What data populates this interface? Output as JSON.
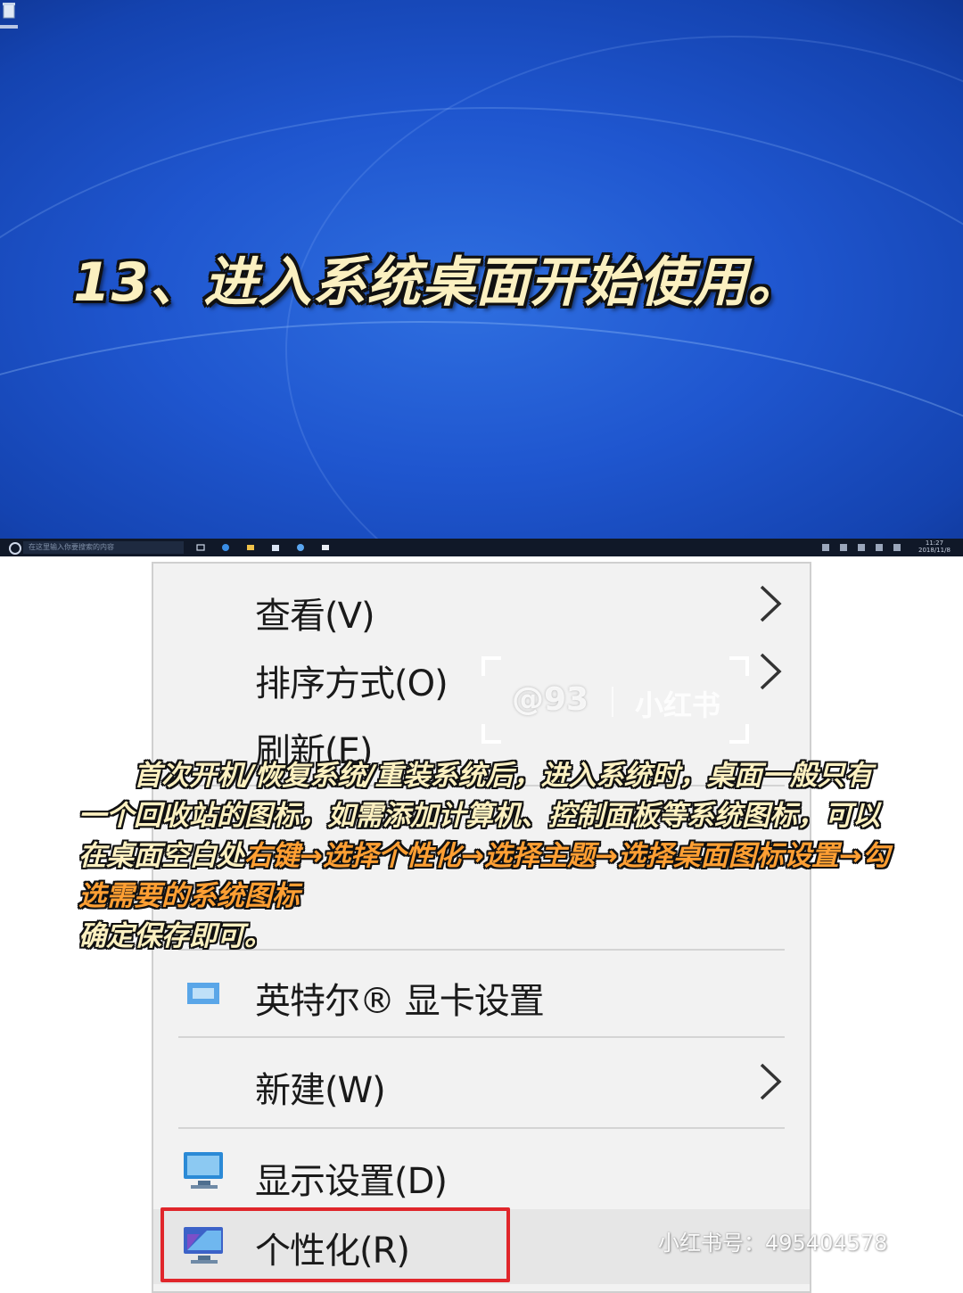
{
  "desktop": {
    "caption": "13、进入系统桌面开始使用。",
    "search_placeholder": "在这里输入你要搜索的内容",
    "clock_time": "11:27",
    "clock_date": "2018/11/8"
  },
  "context_menu": {
    "items": [
      {
        "label": "查看(V)",
        "has_submenu": true
      },
      {
        "label": "排序方式(O)",
        "has_submenu": true
      },
      {
        "label": "刷新(E)",
        "has_submenu": false
      },
      {
        "label": "英特尔® 显卡设置",
        "has_submenu": false,
        "icon": "intel-graphics-icon"
      },
      {
        "label": "新建(W)",
        "has_submenu": true
      },
      {
        "label": "显示设置(D)",
        "has_submenu": false,
        "icon": "display-monitor-icon"
      },
      {
        "label": "个性化(R)",
        "has_submenu": false,
        "icon": "personalize-icon",
        "highlighted": true
      }
    ],
    "highlight_color": "#e0262b"
  },
  "overlay": {
    "part1": "首次开机/恢复系统/重装系统后，进入系统时，桌面一般只有一个回收站的图标，如需添加计算机、控制面板等系统图标，可以在桌面空白处",
    "highlight": "右键→选择个性化→选择主题→选择桌面图标设置→勾选需要的系统图标",
    "part2": "确定保存即可。",
    "text_color": "#fbf0c0",
    "highlight_color": "#ff9f33"
  },
  "watermark": {
    "handle": "@93",
    "brand": "小红书",
    "id_text": "小红书号：495404578"
  }
}
